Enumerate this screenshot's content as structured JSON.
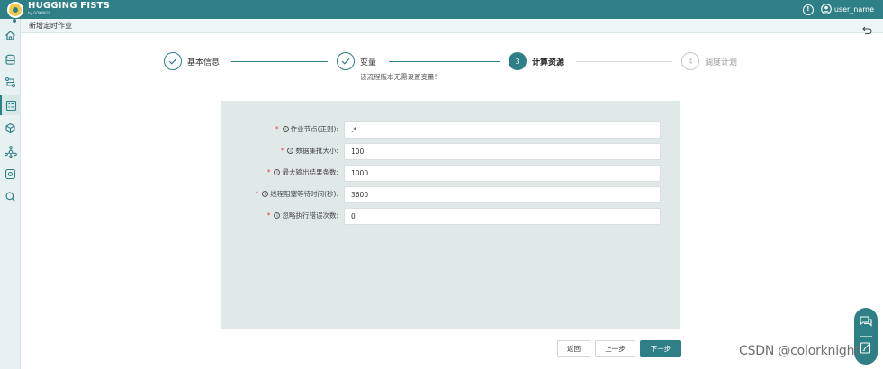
{
  "app": {
    "brand": "HUGGING FISTS",
    "brand_sub": "by GOKINGS",
    "user_name": "user_name"
  },
  "breadcrumb": {
    "title": "新增定时作业"
  },
  "steps": [
    {
      "number": "1",
      "label": "基本信息",
      "state": "done"
    },
    {
      "number": "2",
      "label": "变量",
      "state": "done",
      "sub": "该流程版本无需设置变量!"
    },
    {
      "number": "3",
      "label": "计算资源",
      "state": "current"
    },
    {
      "number": "4",
      "label": "调度计划",
      "state": "todo"
    }
  ],
  "form": {
    "fields": [
      {
        "label": "作业节点(正则):",
        "value": ".*"
      },
      {
        "label": "数据集批大小:",
        "value": "100"
      },
      {
        "label": "最大输出结果条数:",
        "value": "1000"
      },
      {
        "label": "线程阻塞等待时间(秒):",
        "value": "3600"
      },
      {
        "label": "忽略执行错误次数:",
        "value": "0"
      }
    ]
  },
  "buttons": {
    "back": "返回",
    "prev": "上一步",
    "next": "下一步"
  },
  "watermark": "CSDN @colorknight",
  "colors": {
    "accent": "#2e7f86",
    "panel": "#e1e9e8",
    "required": "#e04848"
  },
  "icons": {
    "sidebar": [
      "home-icon",
      "database-icon",
      "flow-icon",
      "task-list-icon",
      "cube-icon",
      "cluster-icon",
      "settings-icon",
      "search-icon"
    ],
    "top": [
      "info-icon",
      "user-icon"
    ],
    "float": [
      "chat-icon",
      "feedback-icon"
    ]
  }
}
